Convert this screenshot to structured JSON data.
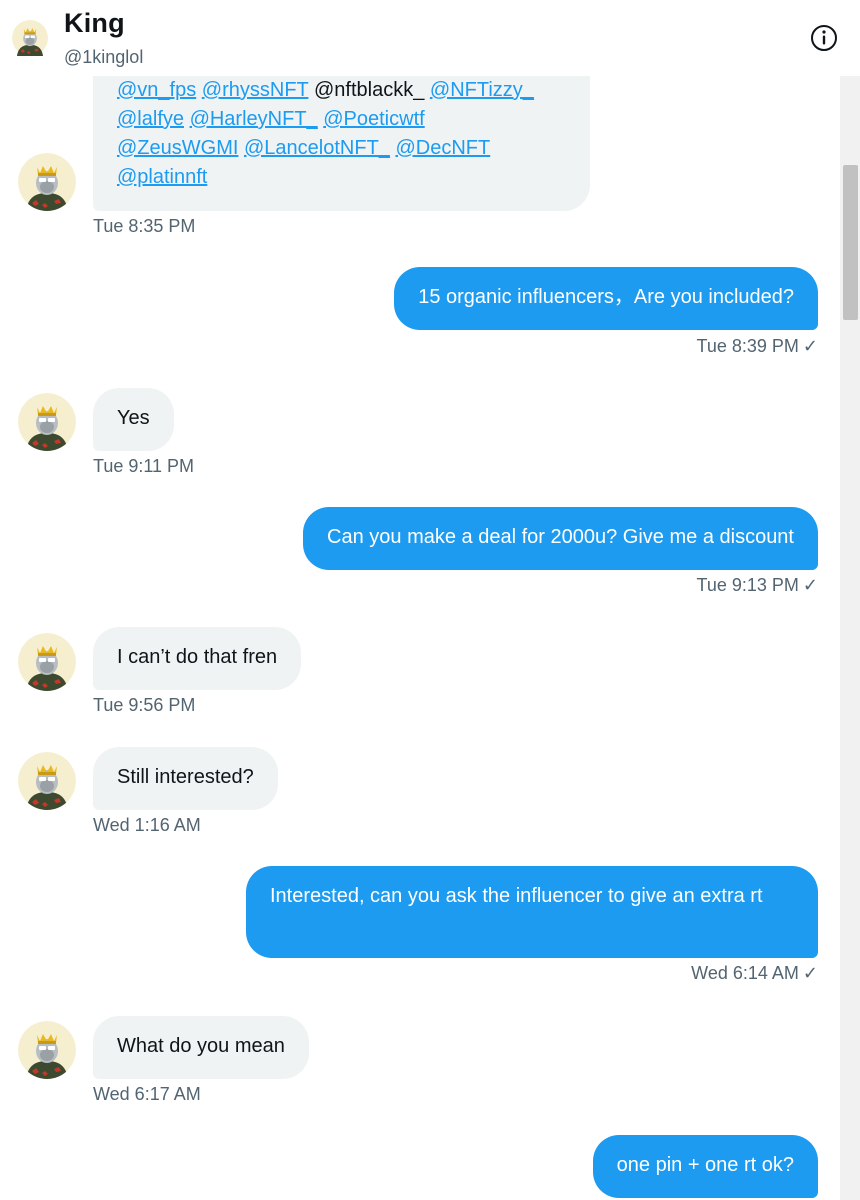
{
  "header": {
    "name": "King",
    "handle": "@1kinglol"
  },
  "first_message": {
    "mentions": [
      [
        "@vn_fps",
        "@rhyssNFT",
        "@nftblackk_",
        "@NFTizzy_"
      ],
      [
        "@lalfye",
        "@HarleyNFT_",
        "@Poeticwtf"
      ],
      [
        "@ZeusWGMI",
        "@LancelotNFT_",
        "@DecNFT"
      ],
      [
        "@platinnft"
      ]
    ],
    "timestamp": "Tue 8:35 PM"
  },
  "messages": [
    {
      "from": "me",
      "text": "15 organic influencers，Are you included?",
      "timestamp": "Tue 8:39 PM"
    },
    {
      "from": "them",
      "text": "Yes",
      "timestamp": "Tue 9:11 PM"
    },
    {
      "from": "me",
      "text": "Can you make a deal for 2000u? Give me a discount",
      "timestamp": "Tue 9:13 PM"
    },
    {
      "from": "them",
      "text": "I can’t do that fren",
      "timestamp": "Tue 9:56 PM"
    },
    {
      "from": "them",
      "text": "Still interested?",
      "timestamp": "Wed 1:16 AM"
    },
    {
      "from": "me",
      "text": "Interested, can you ask the influencer to give an extra rt",
      "timestamp": "Wed 6:14 AM"
    },
    {
      "from": "them",
      "text": "What do you mean",
      "timestamp": "Wed 6:17 AM"
    },
    {
      "from": "me",
      "text": "one pin + one rt ok?",
      "timestamp": ""
    }
  ],
  "read_check": "✓",
  "colors": {
    "accent": "#1d9bf0",
    "incoming_bubble": "#eff3f4",
    "secondary_text": "#536471"
  },
  "icons": [
    "info-icon",
    "avatar-icon",
    "checkmark-icon"
  ]
}
